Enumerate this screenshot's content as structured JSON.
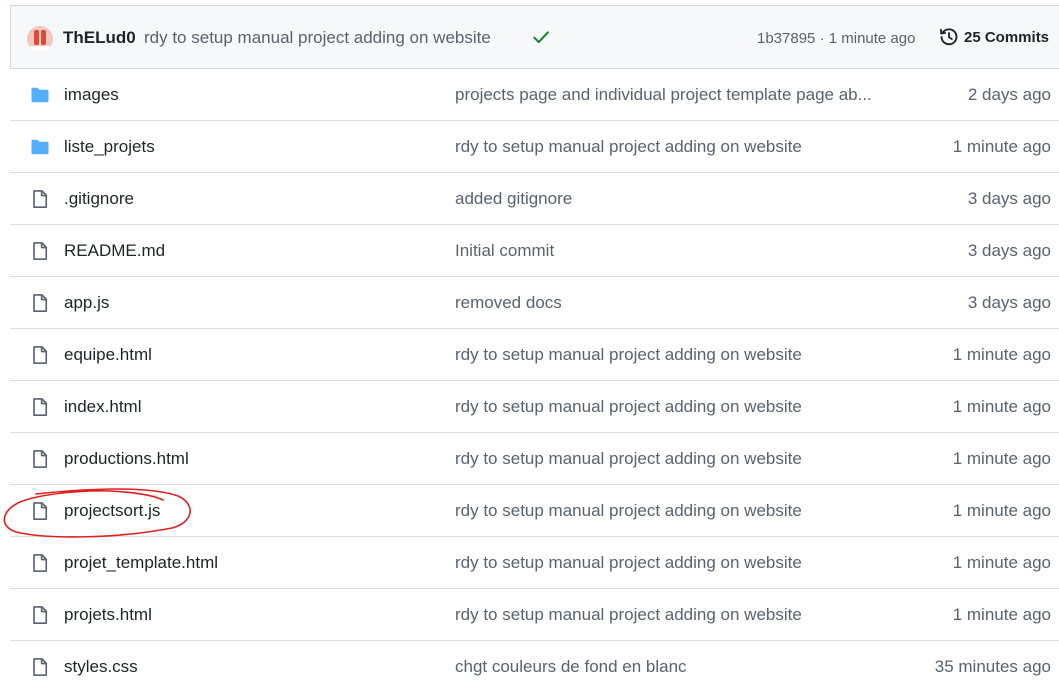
{
  "latest_commit": {
    "author": "ThELud0",
    "message": "rdy to setup manual project adding on website",
    "status_icon": "check-icon",
    "hash_time": "1b37895 · 1 minute ago",
    "commits_label": "25 Commits"
  },
  "colors": {
    "folder": "#54aeff",
    "check": "#1a7f37",
    "annotation": "#e02020"
  },
  "files": [
    {
      "type": "folder",
      "name": "images",
      "message": "projects page and individual project template page ab...",
      "age": "2 days ago"
    },
    {
      "type": "folder",
      "name": "liste_projets",
      "message": "rdy to setup manual project adding on website",
      "age": "1 minute ago"
    },
    {
      "type": "file",
      "name": ".gitignore",
      "message": "added gitignore",
      "age": "3 days ago"
    },
    {
      "type": "file",
      "name": "README.md",
      "message": "Initial commit",
      "age": "3 days ago"
    },
    {
      "type": "file",
      "name": "app.js",
      "message": "removed docs",
      "age": "3 days ago"
    },
    {
      "type": "file",
      "name": "equipe.html",
      "message": "rdy to setup manual project adding on website",
      "age": "1 minute ago"
    },
    {
      "type": "file",
      "name": "index.html",
      "message": "rdy to setup manual project adding on website",
      "age": "1 minute ago"
    },
    {
      "type": "file",
      "name": "productions.html",
      "message": "rdy to setup manual project adding on website",
      "age": "1 minute ago"
    },
    {
      "type": "file",
      "name": "projectsort.js",
      "message": "rdy to setup manual project adding on website",
      "age": "1 minute ago"
    },
    {
      "type": "file",
      "name": "projet_template.html",
      "message": "rdy to setup manual project adding on website",
      "age": "1 minute ago"
    },
    {
      "type": "file",
      "name": "projets.html",
      "message": "rdy to setup manual project adding on website",
      "age": "1 minute ago"
    },
    {
      "type": "file",
      "name": "styles.css",
      "message": "chgt couleurs de fond en blanc",
      "age": "35 minutes ago"
    }
  ]
}
